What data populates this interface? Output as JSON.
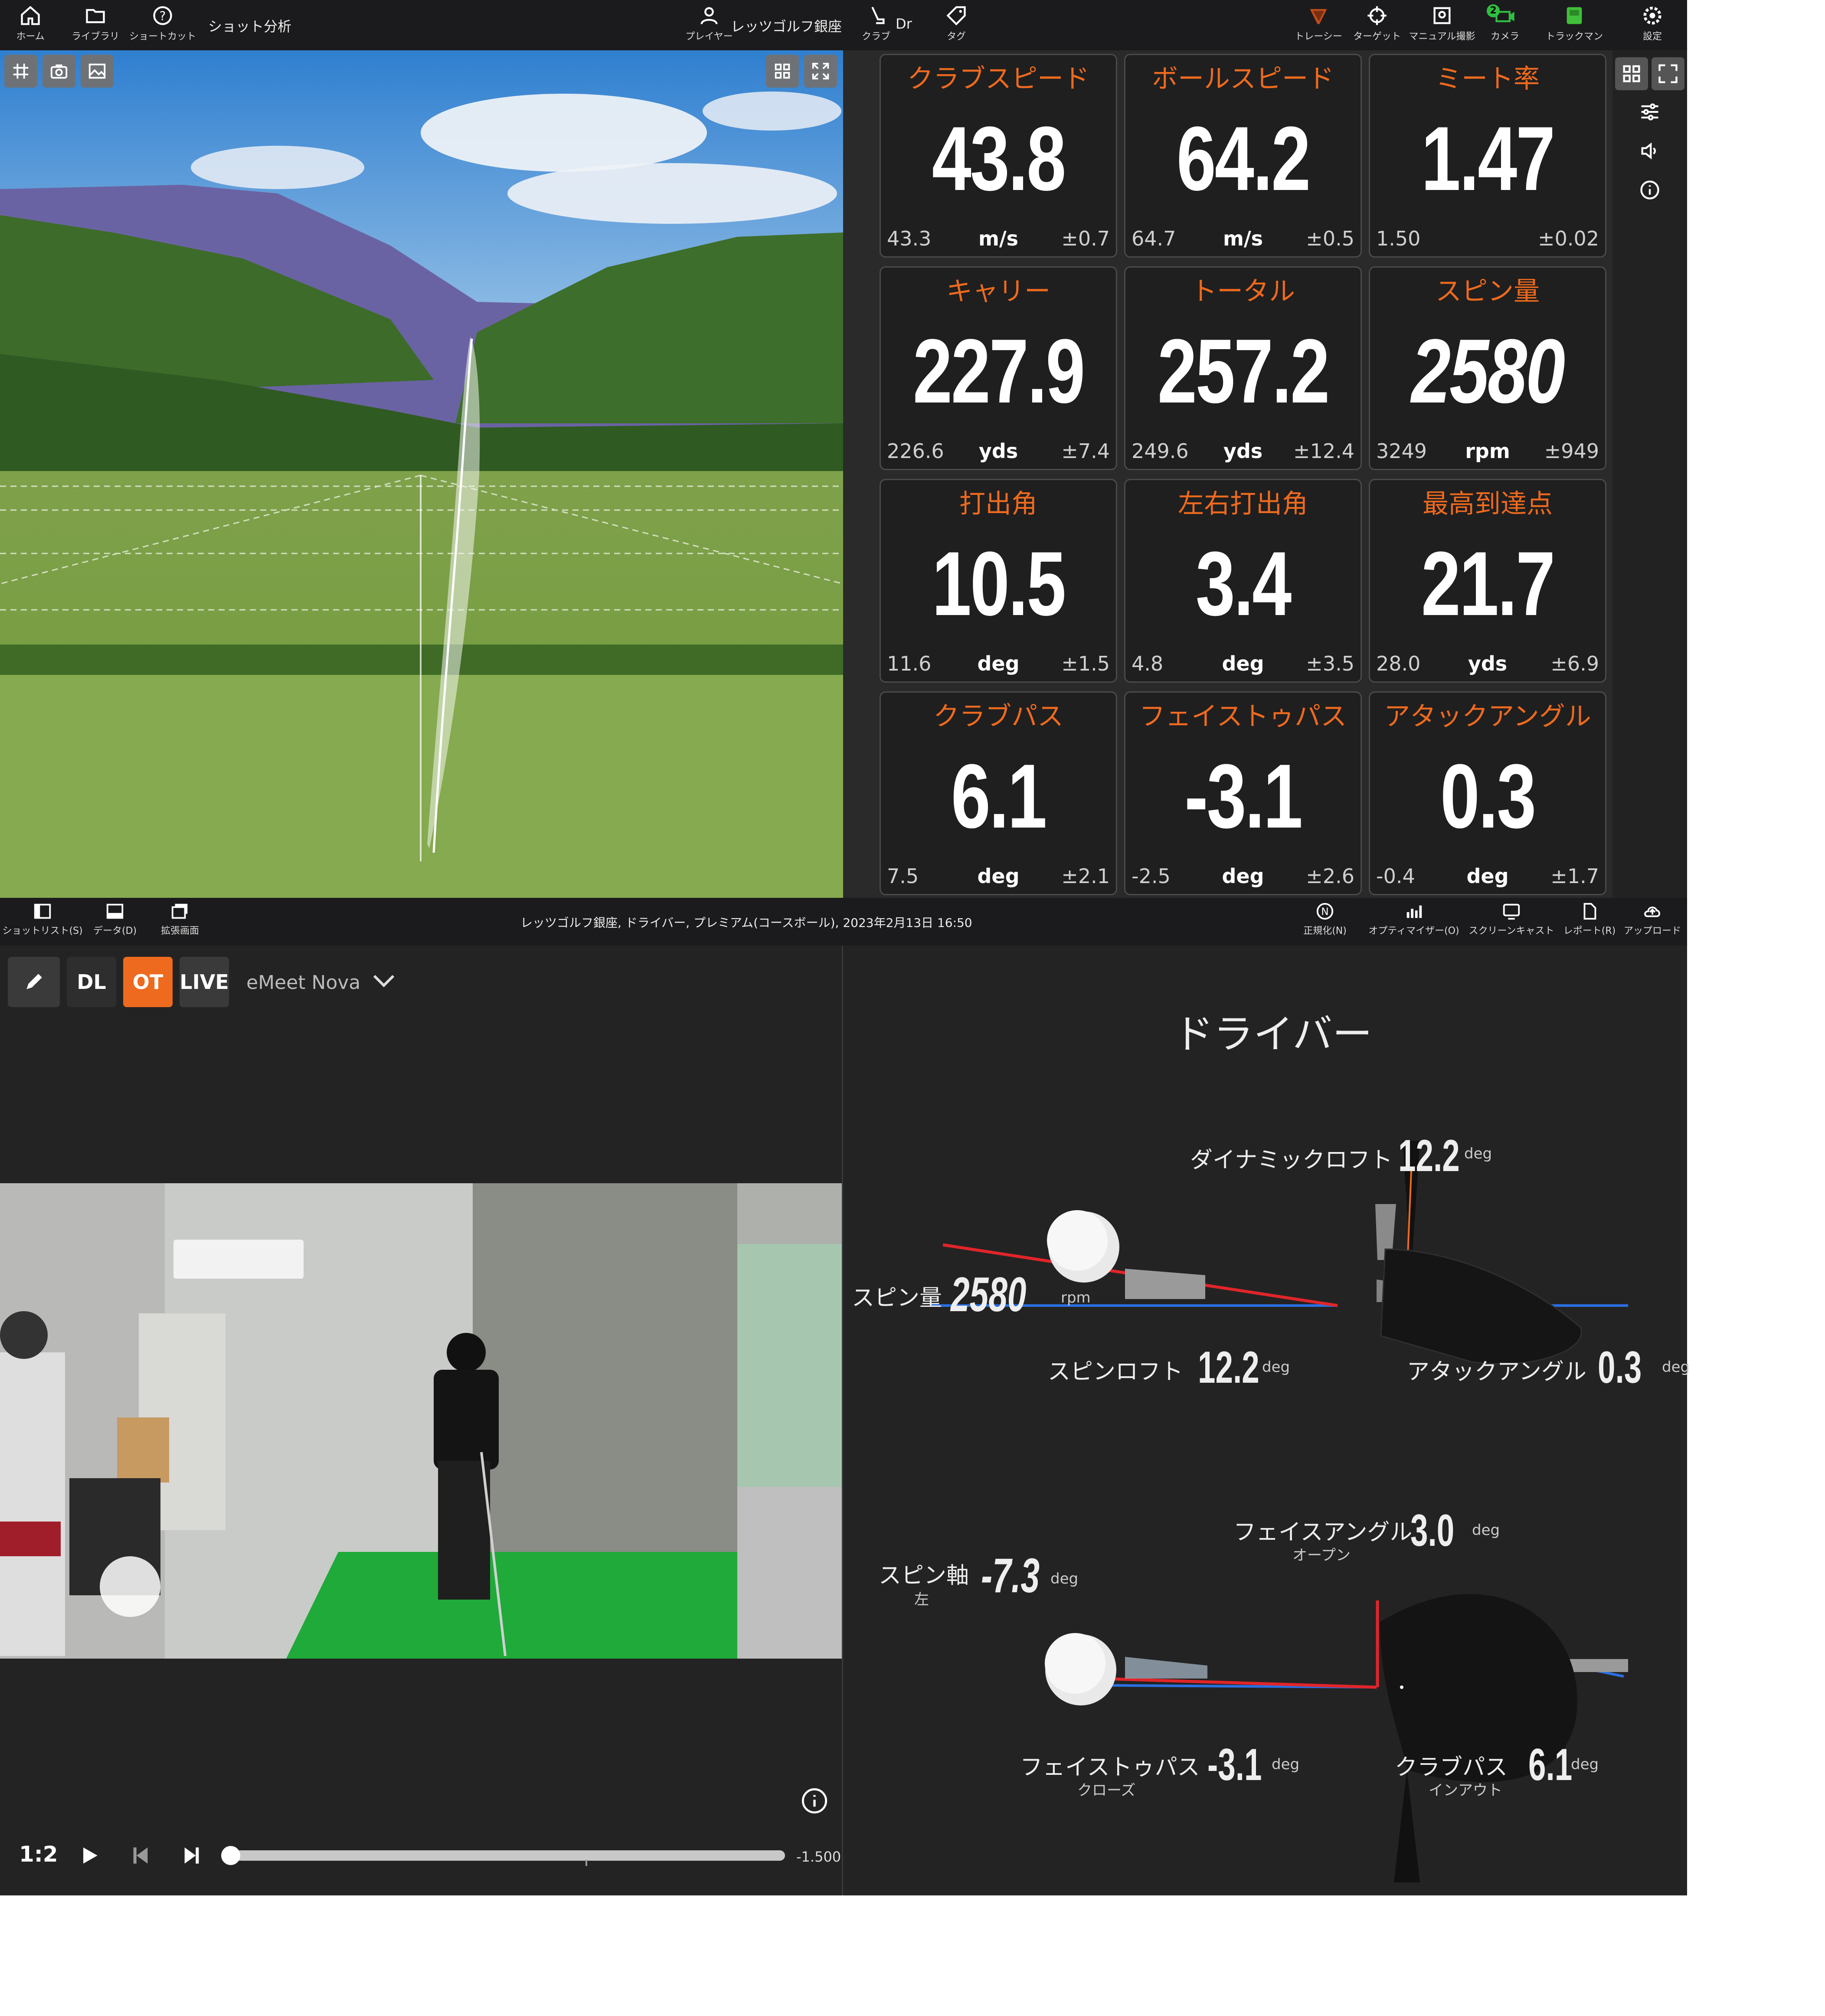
{
  "toolbar": {
    "home": "ホーム",
    "library": "ライブラリ",
    "shortcut": "ショートカット",
    "shot_analysis": "ショット分析",
    "player_name": "レッツゴルフ銀座",
    "player_label": "プレイヤー",
    "club_value": "Dr",
    "club_label": "クラブ",
    "tag_label": "タグ",
    "tracer": "トレーシー",
    "target": "ターゲット",
    "manual": "マニュアル撮影",
    "camera": "カメラ",
    "camera_badge": "2",
    "trackman": "トラックマン",
    "settings": "設定"
  },
  "metrics": [
    {
      "title": "クラブスピード",
      "value": "43.8",
      "avg": "43.3",
      "unit": "m/s",
      "dev": "±0.7"
    },
    {
      "title": "ボールスピード",
      "value": "64.2",
      "avg": "64.7",
      "unit": "m/s",
      "dev": "±0.5"
    },
    {
      "title": "ミート率",
      "value": "1.47",
      "avg": "1.50",
      "unit": "",
      "dev": "±0.02"
    },
    {
      "title": "キャリー",
      "value": "227.9",
      "avg": "226.6",
      "unit": "yds",
      "dev": "±7.4"
    },
    {
      "title": "トータル",
      "value": "257.2",
      "avg": "249.6",
      "unit": "yds",
      "dev": "±12.4"
    },
    {
      "title": "スピン量",
      "value": "2580",
      "avg": "3249",
      "unit": "rpm",
      "dev": "±949"
    },
    {
      "title": "打出角",
      "value": "10.5",
      "avg": "11.6",
      "unit": "deg",
      "dev": "±1.5"
    },
    {
      "title": "左右打出角",
      "value": "3.4",
      "avg": "4.8",
      "unit": "deg",
      "dev": "±3.5"
    },
    {
      "title": "最高到達点",
      "value": "21.7",
      "avg": "28.0",
      "unit": "yds",
      "dev": "±6.9"
    },
    {
      "title": "クラブパス",
      "value": "6.1",
      "avg": "7.5",
      "unit": "deg",
      "dev": "±2.1"
    },
    {
      "title": "フェイストゥパス",
      "value": "-3.1",
      "avg": "-2.5",
      "unit": "deg",
      "dev": "±2.6"
    },
    {
      "title": "アタックアングル",
      "value": "0.3",
      "avg": "-0.4",
      "unit": "deg",
      "dev": "±1.7"
    }
  ],
  "bar2": {
    "shot_list": "ショットリスト(S)",
    "data": "データ(D)",
    "expand": "拡張画面",
    "session_info": "レッツゴルフ銀座, ドライバー, プレミアム(コースボール), 2023年2月13日 16:50",
    "normalize": "正規化(N)",
    "optimizer": "オプティマイザー(O)",
    "screencast": "スクリーンキャスト",
    "report": "レポート(R)",
    "upload": "アップロード"
  },
  "video": {
    "btn_dl": "DL",
    "btn_ot": "OT",
    "btn_live": "LIVE",
    "camera_name": "eMeet Nova",
    "speed": "1:2",
    "time": "-1.500",
    "progress": 0.0
  },
  "analysis": {
    "title": "ドライバー",
    "dynamic_loft_label": "ダイナミックロフト",
    "dynamic_loft_value": "12.2",
    "spin_label": "スピン量",
    "spin_value": "2580",
    "spin_unit": "rpm",
    "spin_loft_label": "スピンロフト",
    "spin_loft_value": "12.2",
    "attack_label": "アタックアングル",
    "attack_value": "0.3",
    "face_angle_label": "フェイスアングル",
    "face_angle_sub": "オープン",
    "face_angle_value": "3.0",
    "spin_axis_label": "スピン軸",
    "spin_axis_sub": "左",
    "spin_axis_value": "-7.3",
    "ftp_label": "フェイストゥパス",
    "ftp_sub": "クローズ",
    "ftp_value": "-3.1",
    "club_path_label": "クラブパス",
    "club_path_sub": "インアウト",
    "club_path_value": "6.1",
    "unit_deg": "deg"
  },
  "colors": {
    "accent": "#ee6a1e",
    "panel": "#1f1f1f",
    "toolbar": "#1b1b1d",
    "red_line": "#e0252a",
    "blue_line": "#2a6fe0"
  }
}
